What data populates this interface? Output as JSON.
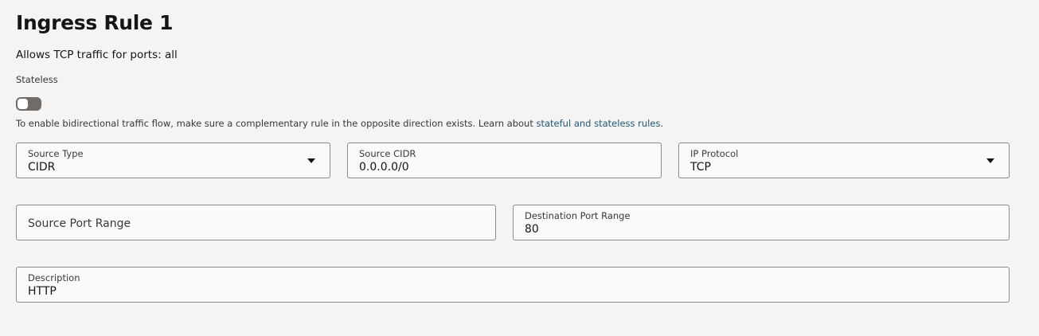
{
  "rule": {
    "title": "Ingress Rule 1",
    "summary": "Allows TCP traffic for ports: all"
  },
  "stateless": {
    "label": "Stateless",
    "enabled": false,
    "help_text": "To enable bidirectional traffic flow, make sure a complementary rule in the opposite direction exists. Learn about ",
    "help_link": "stateful and stateless rules",
    "help_suffix": "."
  },
  "fields": {
    "source_type": {
      "label": "Source Type",
      "value": "CIDR",
      "icon": "chevron-down-icon"
    },
    "source_cidr": {
      "label": "Source CIDR",
      "value": "0.0.0.0/0"
    },
    "ip_protocol": {
      "label": "IP Protocol",
      "value": "TCP",
      "icon": "chevron-down-icon"
    },
    "source_port_range": {
      "label": "Source Port Range",
      "value": ""
    },
    "destination_port_range": {
      "label": "Destination Port Range",
      "value": "80"
    },
    "description": {
      "label": "Description",
      "value": "HTTP"
    }
  },
  "colors": {
    "background": "#f5f4f2",
    "field_background": "#fbfaf9",
    "field_border": "#8d8a87",
    "link": "#20587a",
    "toggle_off": "#6f6c69"
  }
}
